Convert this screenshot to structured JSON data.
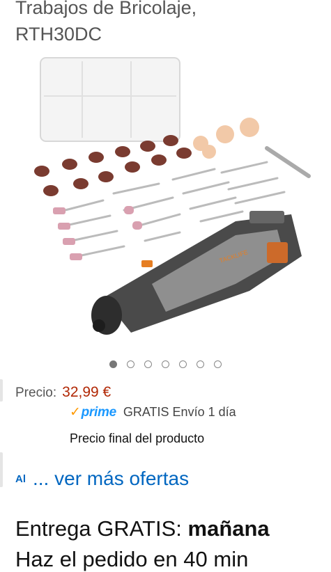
{
  "product": {
    "title_line1": "Trabajos de Bricolaje,",
    "title_line2": "RTH30DC",
    "brand_on_tool": "TACKLIFE"
  },
  "carousel": {
    "count": 7,
    "active_index": 0
  },
  "price": {
    "label": "Precio:",
    "value": "32,99 €"
  },
  "prime": {
    "check": "✓",
    "logo": "prime",
    "shipping": "GRATIS Envío 1 día"
  },
  "final_price_note": "Precio final del producto",
  "offers": {
    "prefix": "Al",
    "link": "... ver más ofertas"
  },
  "delivery": {
    "prefix": "Entrega GRATIS: ",
    "day": "mañana"
  },
  "cutoff": "Haz el pedido en 40 min",
  "colors": {
    "price": "#b12704",
    "link": "#0066c0",
    "prime": "#1a98ff"
  }
}
